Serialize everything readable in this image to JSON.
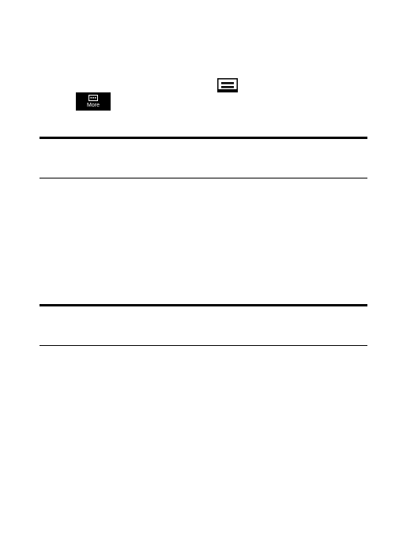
{
  "icons": {
    "menu_key": "menu-key-icon",
    "more": {
      "icon": "more-icon",
      "label": "More"
    }
  },
  "colors": {
    "rule": "#000000",
    "background": "#ffffff",
    "icon_fill": "#000000",
    "icon_text": "#ffffff"
  }
}
